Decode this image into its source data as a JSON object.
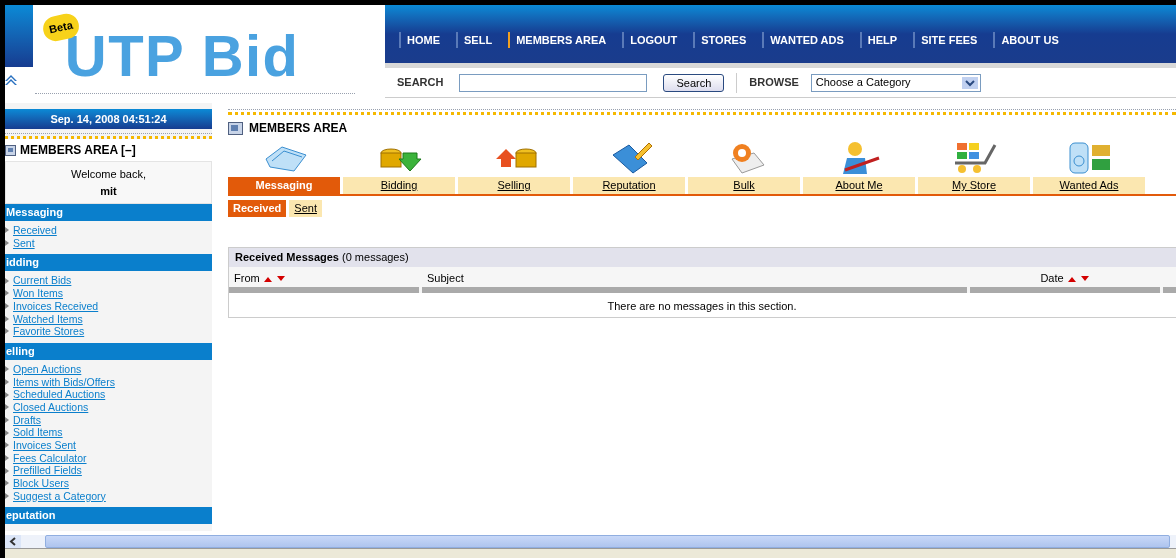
{
  "logo": {
    "badge": "Beta",
    "title": "UTP Bid"
  },
  "nav": [
    {
      "label": "HOME",
      "selected": false
    },
    {
      "label": "SELL",
      "selected": false
    },
    {
      "label": "MEMBERS AREA",
      "selected": true
    },
    {
      "label": "LOGOUT",
      "selected": false
    },
    {
      "label": "STORES",
      "selected": false
    },
    {
      "label": "WANTED ADS",
      "selected": false
    },
    {
      "label": "HELP",
      "selected": false
    },
    {
      "label": "SITE FEES",
      "selected": false
    },
    {
      "label": "ABOUT US",
      "selected": false
    }
  ],
  "search": {
    "label": "SEARCH",
    "button": "Search",
    "browse_label": "BROWSE",
    "category": "Choose a Category"
  },
  "sidebar": {
    "datetime": "Sep. 14, 2008 04:51:24",
    "title": "MEMBERS AREA [–]",
    "welcome": "Welcome back,",
    "user": "mit",
    "sections": [
      {
        "heading": "Messaging",
        "links": [
          "Received",
          "Sent"
        ]
      },
      {
        "heading": "idding",
        "links": [
          "Current Bids",
          "Won Items",
          "Invoices Received",
          "Watched Items",
          "Favorite Stores"
        ]
      },
      {
        "heading": "elling",
        "links": [
          "Open Auctions",
          "Items with Bids/Offers",
          "Scheduled Auctions",
          "Closed Auctions",
          "Drafts",
          "Sold Items",
          "Invoices Sent",
          "Fees Calculator",
          "Prefilled Fields",
          "Block Users",
          "Suggest a Category"
        ]
      },
      {
        "heading": "eputation"
      }
    ]
  },
  "main": {
    "title": "MEMBERS AREA",
    "tabs": [
      {
        "label": "Messaging",
        "selected": true
      },
      {
        "label": "Bidding",
        "selected": false
      },
      {
        "label": "Selling",
        "selected": false
      },
      {
        "label": "Reputation",
        "selected": false
      },
      {
        "label": "Bulk",
        "selected": false
      },
      {
        "label": "About Me",
        "selected": false
      },
      {
        "label": "My Store",
        "selected": false
      },
      {
        "label": "Wanted Ads",
        "selected": false
      }
    ],
    "subtabs": [
      {
        "label": "Received",
        "selected": true
      },
      {
        "label": "Sent",
        "selected": false
      }
    ],
    "table": {
      "title": "Received Messages",
      "count": "(0 messages)",
      "columns": [
        {
          "label": "From",
          "sortable": true
        },
        {
          "label": "Subject",
          "sortable": false
        },
        {
          "label": "Date",
          "sortable": true
        }
      ],
      "empty": "There are no messages in this section."
    }
  }
}
